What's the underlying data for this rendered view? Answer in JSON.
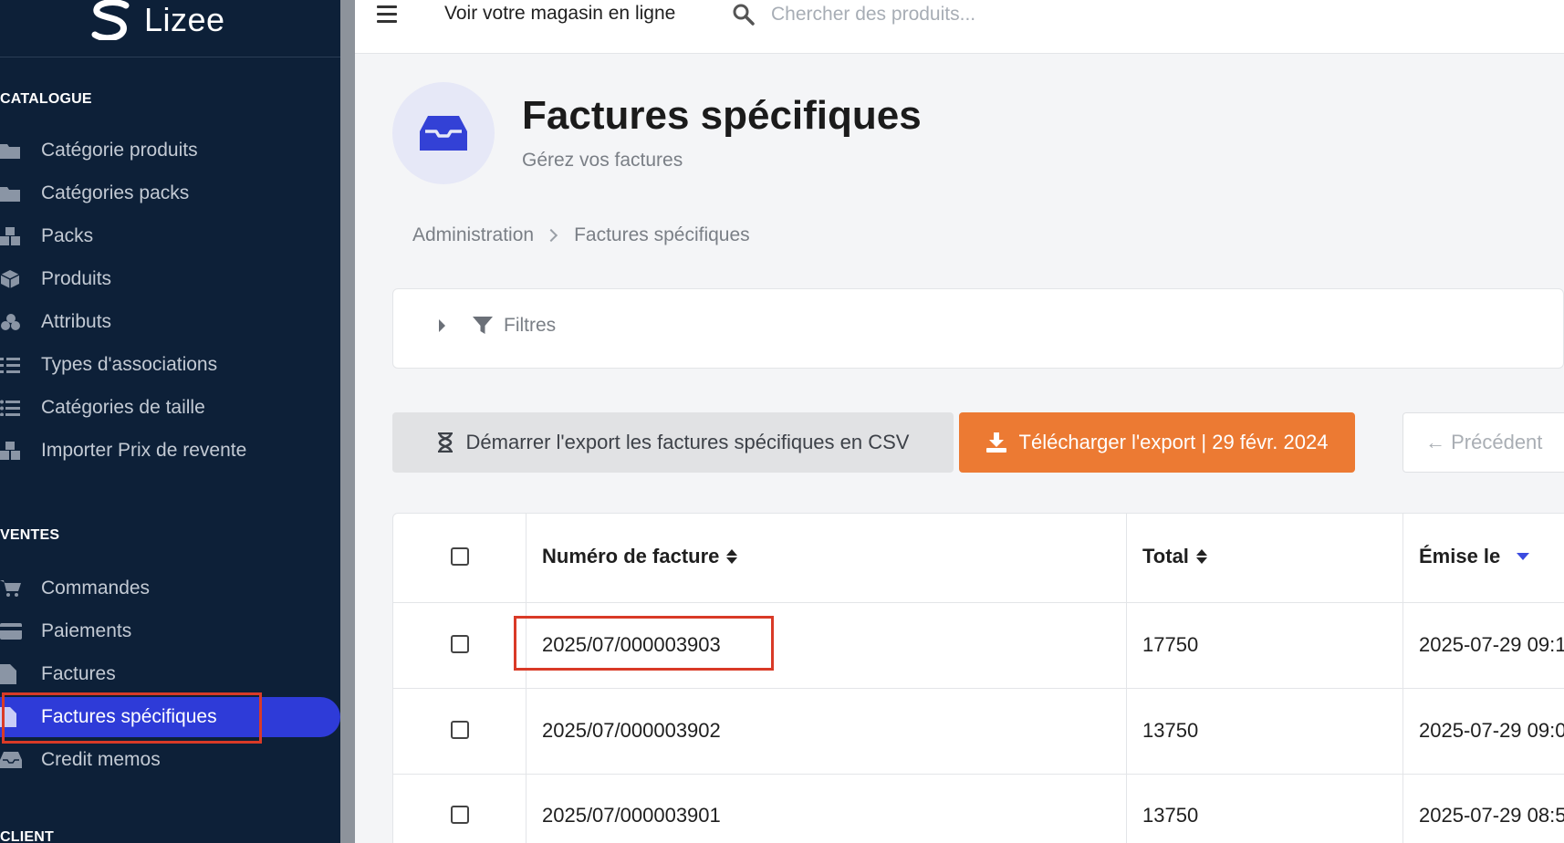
{
  "brand": {
    "name": "Lizee"
  },
  "topbar": {
    "store_link": "Voir votre magasin en ligne",
    "search_placeholder": "Chercher des produits..."
  },
  "sidebar": {
    "sections": [
      {
        "title": "CATALOGUE"
      },
      {
        "title": "VENTES"
      },
      {
        "title": "CLIENT"
      }
    ],
    "catalogue_items": [
      {
        "label": "Catégorie produits",
        "icon": "folder-icon"
      },
      {
        "label": "Catégories packs",
        "icon": "folder-icon"
      },
      {
        "label": "Packs",
        "icon": "cubes-icon"
      },
      {
        "label": "Produits",
        "icon": "cube-icon"
      },
      {
        "label": "Attributs",
        "icon": "cubes-small-icon"
      },
      {
        "label": "Types d'associations",
        "icon": "tasks-icon"
      },
      {
        "label": "Catégories de taille",
        "icon": "list-icon"
      },
      {
        "label": "Importer Prix de revente",
        "icon": "cubes-icon"
      }
    ],
    "ventes_items": [
      {
        "label": "Commandes",
        "icon": "cart-icon"
      },
      {
        "label": "Paiements",
        "icon": "credit-card-icon"
      },
      {
        "label": "Factures",
        "icon": "file-icon"
      },
      {
        "label": "Factures spécifiques",
        "icon": "file-icon",
        "active": true
      },
      {
        "label": "Credit memos",
        "icon": "inbox-icon"
      }
    ]
  },
  "header": {
    "title": "Factures spécifiques",
    "subtitle": "Gérez vos factures",
    "icon": "inbox-icon"
  },
  "breadcrumb": [
    "Administration",
    "Factures spécifiques"
  ],
  "filters": {
    "label": "Filtres"
  },
  "actions": {
    "export_label": "Démarrer l'export les factures spécifiques en CSV",
    "download_label": "Télécharger l'export | 29 févr. 2024",
    "prev_label": "← Précédent"
  },
  "table": {
    "columns": [
      "Numéro de facture",
      "Total",
      "Émise le"
    ],
    "rows": [
      {
        "number": "2025/07/000003903",
        "total": "17750",
        "date": "2025-07-29 09:1"
      },
      {
        "number": "2025/07/000003902",
        "total": "13750",
        "date": "2025-07-29 09:0"
      },
      {
        "number": "2025/07/000003901",
        "total": "13750",
        "date": "2025-07-29 08:5"
      }
    ]
  },
  "colors": {
    "sidebar_bg": "#0d2038",
    "active_item": "#2e3bd8",
    "download_button": "#ec7a33",
    "highlight_box": "#d93a27"
  }
}
